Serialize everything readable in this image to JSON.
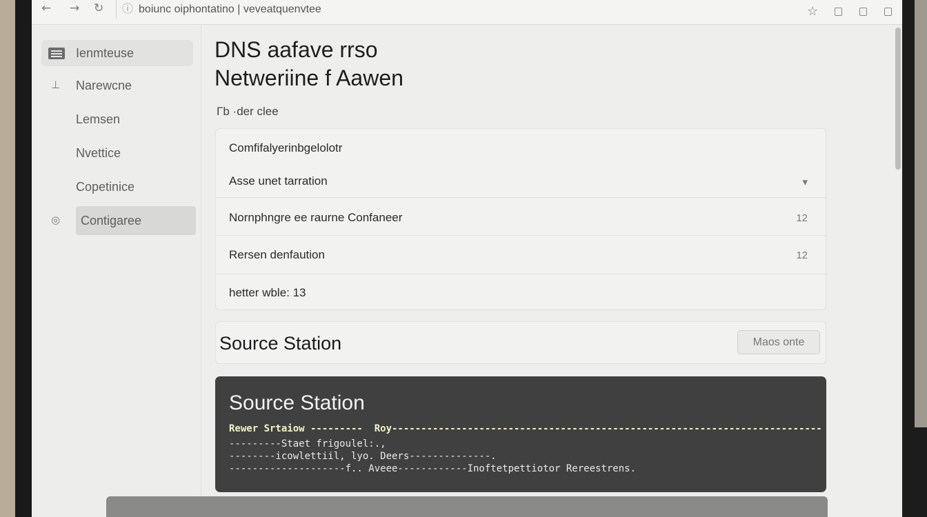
{
  "browser": {
    "address_text": "boiunc oiphontatino | veveatquenvtee"
  },
  "sidebar": {
    "items": [
      {
        "label": "Ienmteuse"
      },
      {
        "label": "Narewcne"
      },
      {
        "label": "Lemsen"
      },
      {
        "label": "Nvettice"
      },
      {
        "label": "Copetinice"
      },
      {
        "label": "Contigaree"
      }
    ]
  },
  "main": {
    "title_line1": "DNS aafave rrso",
    "title_line2": "Netweriine f Aawen",
    "section_label": "Γb ·der clee",
    "panel": {
      "rows": [
        {
          "text": "Comfifalyerinbgelolotr",
          "value": ""
        },
        {
          "text": "Asse unet tarration",
          "value": "▾"
        },
        {
          "text": "Nornphngre ee raurne Confaneer",
          "value": "12"
        },
        {
          "text": "Rersen denfaution",
          "value": "12"
        },
        {
          "text": "hetter wble: 13",
          "value": ""
        }
      ]
    },
    "station_bar": {
      "title": "Source Station",
      "button_label": "Maos onte"
    },
    "terminal": {
      "title": "Source Station",
      "lines": [
        "Rewer Srtaiow ---------  Roy------------------------------------------------------------------------------",
        "---------Staet frigoulel:.,",
        "--------icowlettiil, lyo. Deers--------------.",
        "--------------------f.. Aveee------------Inoftetpettiotor Rereestrens."
      ]
    }
  }
}
